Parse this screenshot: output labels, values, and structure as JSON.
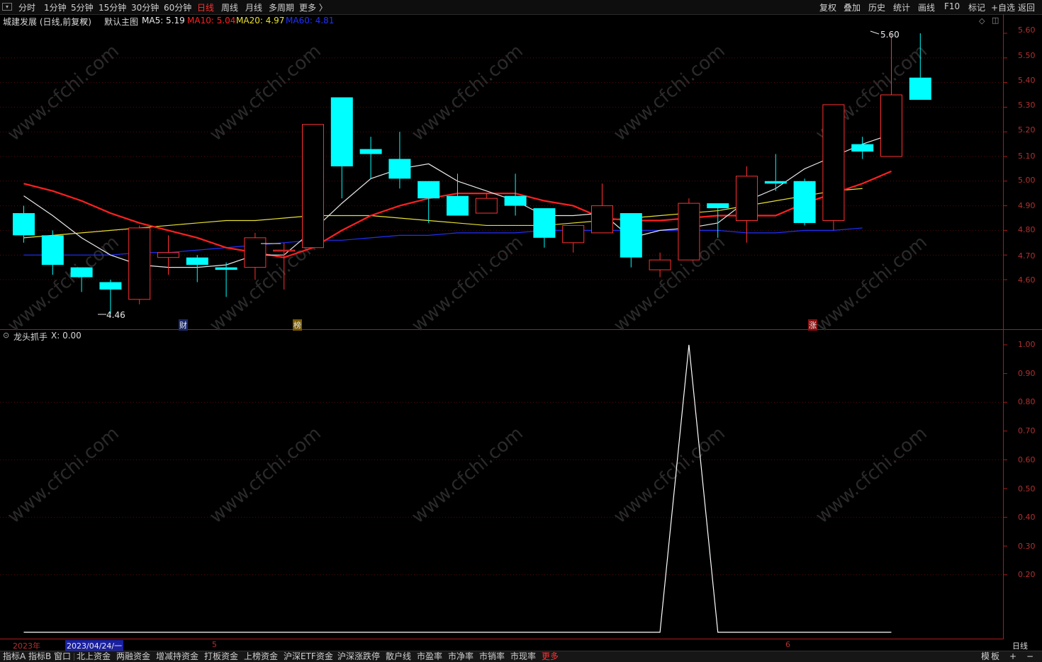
{
  "toolbar": {
    "periods": [
      "分时",
      "1分钟",
      "5分钟",
      "15分钟",
      "30分钟",
      "60分钟",
      "日线",
      "周线",
      "月线",
      "多周期",
      "更多 〉"
    ],
    "active_period": "日线",
    "right": [
      "复权",
      "叠加",
      "历史",
      "统计",
      "画线",
      "F10",
      "标记",
      "+自选",
      "返回"
    ]
  },
  "main_panel": {
    "stock_title": "城建发展 (日线,前复权)",
    "main_chart_label": "默认主图",
    "ma_labels": [
      {
        "text": "MA5: 5.19",
        "color": "#e8e8e8"
      },
      {
        "text": "MA10: 5.04",
        "color": "#ff2020"
      },
      {
        "text": "MA20: 4.97",
        "color": "#e8e030"
      },
      {
        "text": "MA60: 4.81",
        "color": "#2030ff"
      }
    ],
    "high_label": "5.60",
    "low_label": "4.46",
    "markers": [
      "财",
      "榜",
      "涨"
    ],
    "y_ticks": [
      "5.60",
      "5.50",
      "5.40",
      "5.30",
      "5.20",
      "5.10",
      "5.00",
      "4.90",
      "4.80",
      "4.70",
      "4.60"
    ]
  },
  "indicator_panel": {
    "name": "龙头抓手",
    "value_label": "X: 0.00",
    "y_ticks": [
      "1.00",
      "0.90",
      "0.80",
      "0.70",
      "0.60",
      "0.50",
      "0.40",
      "0.30",
      "0.20"
    ]
  },
  "date_axis": {
    "year": "2023年",
    "cursor_date": "2023/04/24/一",
    "month_5": "5",
    "month_6": "6",
    "period": "日线"
  },
  "bottom_tabs": [
    "指标A",
    "指标B",
    "窗口",
    "北上资金",
    "两融资金",
    "增减持资金",
    "打板资金",
    "上榜资金",
    "沪深ETF资金",
    "沪深涨跌停",
    "散户线",
    "市盈率",
    "市净率",
    "市销率",
    "市现率",
    "更多"
  ],
  "bottom_right": [
    "模",
    "板",
    "+",
    "−"
  ],
  "colors": {
    "up": "#ff3030",
    "down": "#00ffff",
    "ma5": "#e8e8e8",
    "ma10": "#ff2020",
    "ma20": "#e8e030",
    "ma60": "#2030ff",
    "axis": "#b01818"
  },
  "chart_data": {
    "type": "candlestick",
    "candles": [
      {
        "o": 4.87,
        "h": 4.9,
        "l": 4.75,
        "c": 4.78
      },
      {
        "o": 4.78,
        "h": 4.8,
        "l": 4.62,
        "c": 4.66
      },
      {
        "o": 4.65,
        "h": 4.65,
        "l": 4.55,
        "c": 4.61
      },
      {
        "o": 4.59,
        "h": 4.6,
        "l": 4.46,
        "c": 4.56
      },
      {
        "o": 4.52,
        "h": 4.82,
        "l": 4.5,
        "c": 4.81
      },
      {
        "o": 4.69,
        "h": 4.78,
        "l": 4.62,
        "c": 4.71
      },
      {
        "o": 4.69,
        "h": 4.7,
        "l": 4.59,
        "c": 4.66
      },
      {
        "o": 4.65,
        "h": 4.67,
        "l": 4.53,
        "c": 4.64
      },
      {
        "o": 4.65,
        "h": 4.79,
        "l": 4.6,
        "c": 4.77
      },
      {
        "o": 4.72,
        "h": 4.75,
        "l": 4.56,
        "c": 4.72
      },
      {
        "o": 4.73,
        "h": 5.23,
        "l": 4.73,
        "c": 5.23
      },
      {
        "o": 5.34,
        "h": 5.34,
        "l": 4.93,
        "c": 5.06
      },
      {
        "o": 5.13,
        "h": 5.18,
        "l": 5.01,
        "c": 5.11
      },
      {
        "o": 5.09,
        "h": 5.2,
        "l": 4.97,
        "c": 5.01
      },
      {
        "o": 5.0,
        "h": 5.0,
        "l": 4.83,
        "c": 4.93
      },
      {
        "o": 4.94,
        "h": 5.03,
        "l": 4.86,
        "c": 4.86
      },
      {
        "o": 4.87,
        "h": 4.95,
        "l": 4.87,
        "c": 4.93
      },
      {
        "o": 4.94,
        "h": 5.03,
        "l": 4.86,
        "c": 4.9
      },
      {
        "o": 4.89,
        "h": 4.89,
        "l": 4.73,
        "c": 4.77
      },
      {
        "o": 4.75,
        "h": 4.79,
        "l": 4.71,
        "c": 4.82
      },
      {
        "o": 4.79,
        "h": 4.99,
        "l": 4.79,
        "c": 4.9
      },
      {
        "o": 4.87,
        "h": 4.87,
        "l": 4.65,
        "c": 4.69
      },
      {
        "o": 4.64,
        "h": 4.71,
        "l": 4.61,
        "c": 4.68
      },
      {
        "o": 4.68,
        "h": 4.93,
        "l": 4.68,
        "c": 4.91
      },
      {
        "o": 4.91,
        "h": 4.91,
        "l": 4.77,
        "c": 4.89
      },
      {
        "o": 4.84,
        "h": 5.06,
        "l": 4.75,
        "c": 5.02
      },
      {
        "o": 5.0,
        "h": 5.11,
        "l": 4.96,
        "c": 4.99
      },
      {
        "o": 5.0,
        "h": 5.01,
        "l": 4.82,
        "c": 4.83
      },
      {
        "o": 4.84,
        "h": 5.31,
        "l": 4.8,
        "c": 5.31
      },
      {
        "o": 5.15,
        "h": 5.18,
        "l": 5.09,
        "c": 5.12
      },
      {
        "o": 5.1,
        "h": 5.6,
        "l": 5.1,
        "c": 5.35
      },
      {
        "o": 5.42,
        "h": 5.6,
        "l": 5.33,
        "c": 5.33
      }
    ],
    "ma5": [
      4.94,
      4.86,
      4.77,
      4.7,
      4.66,
      4.65,
      4.65,
      4.66,
      4.7,
      4.7,
      4.8,
      4.91,
      5.01,
      5.05,
      5.07,
      5.0,
      4.96,
      4.92,
      4.86,
      4.86,
      4.87,
      4.77,
      4.8,
      4.81,
      4.83,
      4.92,
      4.97,
      5.05,
      5.1,
      5.15,
      5.19
    ],
    "ma10": [
      4.99,
      4.96,
      4.92,
      4.87,
      4.83,
      4.8,
      4.77,
      4.73,
      4.71,
      4.69,
      4.73,
      4.8,
      4.86,
      4.9,
      4.93,
      4.95,
      4.95,
      4.95,
      4.92,
      4.9,
      4.85,
      4.84,
      4.84,
      4.85,
      4.86,
      4.86,
      4.86,
      4.91,
      4.95,
      4.99,
      5.04
    ],
    "ma20": [
      4.77,
      4.78,
      4.79,
      4.8,
      4.81,
      4.82,
      4.83,
      4.84,
      4.84,
      4.85,
      4.86,
      4.86,
      4.86,
      4.85,
      4.84,
      4.83,
      4.82,
      4.82,
      4.82,
      4.83,
      4.84,
      4.85,
      4.86,
      4.87,
      4.88,
      4.9,
      4.92,
      4.94,
      4.96,
      4.97
    ],
    "ma60": [
      4.7,
      4.7,
      4.7,
      4.7,
      4.71,
      4.71,
      4.72,
      4.73,
      4.74,
      4.75,
      4.76,
      4.76,
      4.77,
      4.78,
      4.78,
      4.79,
      4.79,
      4.79,
      4.8,
      4.8,
      4.8,
      4.8,
      4.8,
      4.8,
      4.8,
      4.79,
      4.79,
      4.8,
      4.8,
      4.81
    ],
    "indicator_x": [
      0,
      0,
      0,
      0,
      0,
      0,
      0,
      0,
      0,
      0,
      0,
      0,
      0,
      0,
      0,
      0,
      0,
      0,
      0,
      0,
      0,
      0,
      0,
      1,
      0,
      0,
      0,
      0,
      0,
      0,
      0
    ],
    "ylim_main": [
      4.45,
      5.63
    ],
    "ylim_indicator": [
      0,
      1.05
    ]
  }
}
